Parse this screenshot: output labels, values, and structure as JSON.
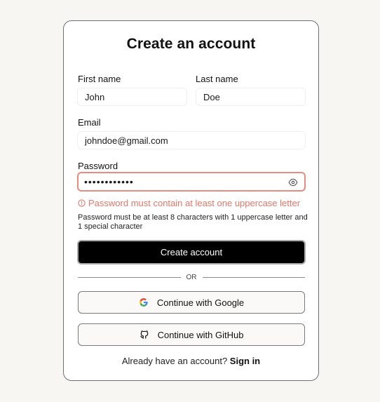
{
  "form": {
    "title": "Create an account",
    "first_name": {
      "label": "First name",
      "value": "John"
    },
    "last_name": {
      "label": "Last name",
      "value": "Doe"
    },
    "email": {
      "label": "Email",
      "value": "johndoe@gmail.com"
    },
    "password": {
      "label": "Password",
      "masked_value": "••••••••••••",
      "error": "Password must contain at least one uppercase letter",
      "hint": "Password must be at least 8 characters with 1 uppercase letter and 1 special character",
      "toggle_icon": "eye-icon"
    },
    "submit_label": "Create account",
    "divider_text": "OR",
    "google_label": "Continue with Google",
    "github_label": "Continue with GitHub",
    "signin_prompt": "Already have an account?",
    "signin_link": "Sign in"
  },
  "colors": {
    "background": "#f7f6f3",
    "primary_button": "#000000",
    "error": "#e4776a",
    "error_border": "#e98b7f"
  }
}
